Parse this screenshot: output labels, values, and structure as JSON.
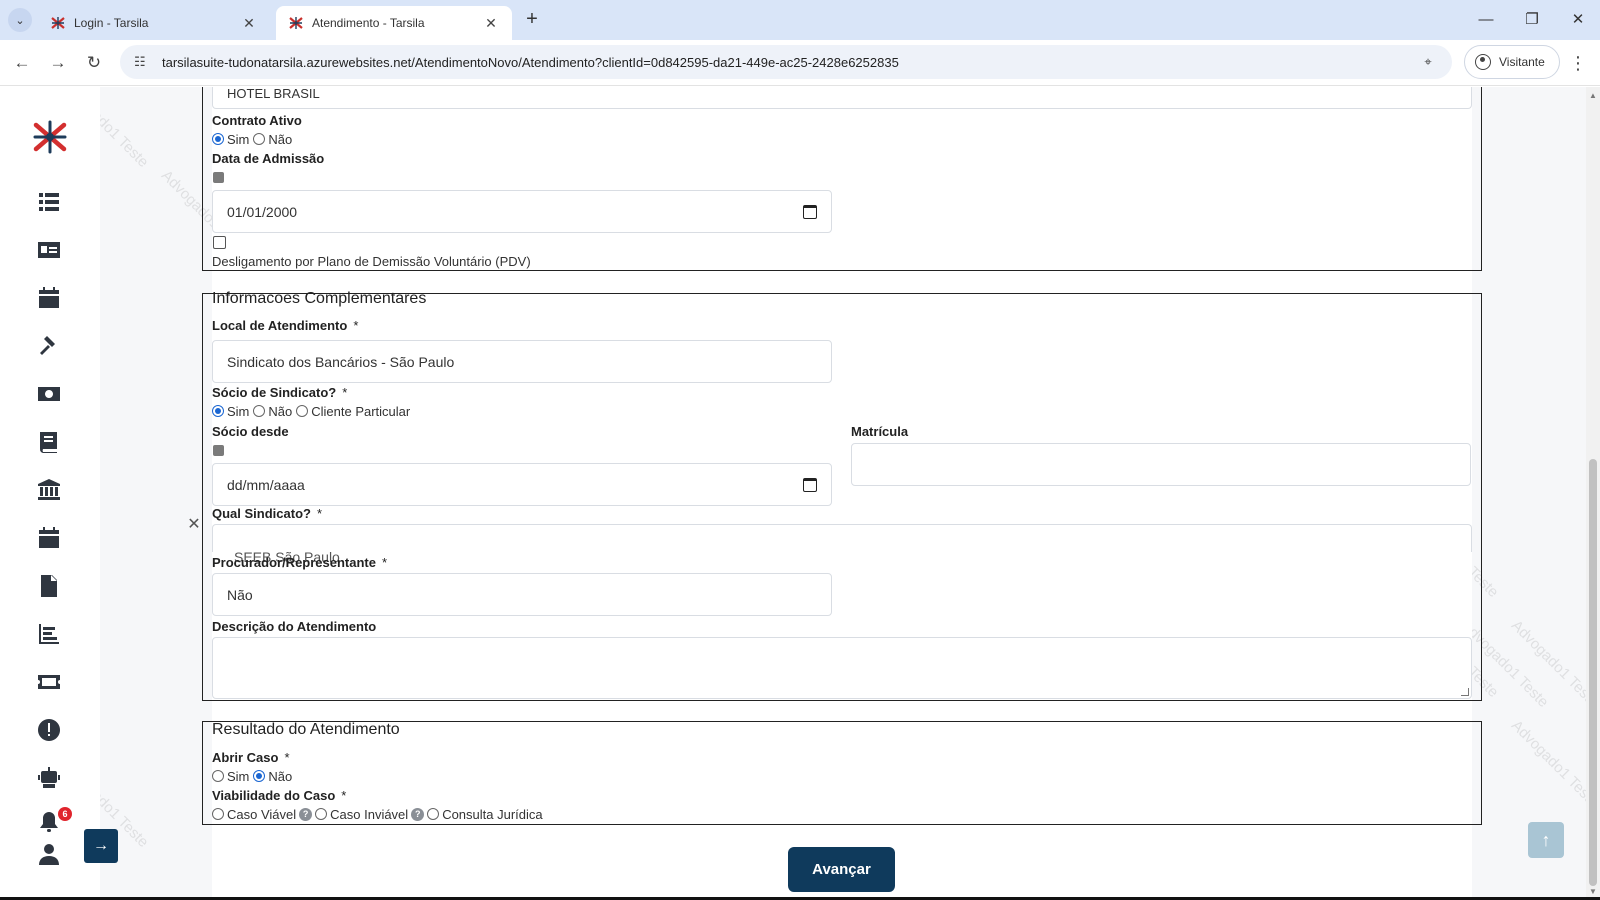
{
  "browser": {
    "tabs": [
      {
        "title": "Login - Tarsila",
        "active": false
      },
      {
        "title": "Atendimento - Tarsila",
        "active": true
      }
    ],
    "url": "tarsilasuite-tudonatarsila.azurewebsites.net/AtendimentoNovo/Atendimento?clientId=0d842595-da21-449e-ac25-2428e6252835",
    "profile_label": "Visitante"
  },
  "watermark_text": "Advogado1 Teste",
  "sidebar": {
    "icons": [
      "list-icon",
      "id-card-icon",
      "calendar-icon",
      "gavel-icon",
      "money-icon",
      "book-icon",
      "bank-icon",
      "calendar-icon",
      "document-icon",
      "chart-icon",
      "ticket-icon",
      "alert-icon",
      "robot-icon",
      "bell-icon",
      "user-icon"
    ],
    "notification_count": "6"
  },
  "contract": {
    "company_value": "HOTEL BRASIL",
    "active_label": "Contrato Ativo",
    "active_options": [
      "Sim",
      "Não"
    ],
    "active_selected": "Sim",
    "admission_label": "Data de Admissão",
    "admission_value": "01/01/2000",
    "pdv_label": "Desligamento por Plano de Demissão Voluntário (PDV)"
  },
  "complementary": {
    "legend": "Informacoes Complementares",
    "local_label": "Local de Atendimento",
    "local_value": "Sindicato dos Bancários - São Paulo",
    "socio_label": "Sócio de Sindicato?",
    "socio_options": [
      "Sim",
      "Não",
      "Cliente Particular"
    ],
    "socio_selected": "Sim",
    "socio_desde_label": "Sócio desde",
    "socio_desde_placeholder": "dd/mm/aaaa",
    "matricula_label": "Matrícula",
    "qual_sindicato_label": "Qual Sindicato?",
    "qual_sindicato_value": "SEEB São Paulo",
    "procurador_label": "Procurador/Representante",
    "procurador_value": "Não",
    "descricao_label": "Descrição do Atendimento",
    "required_mark": "*"
  },
  "result": {
    "legend": "Resultado do Atendimento",
    "abrir_caso_label": "Abrir Caso",
    "abrir_caso_options": [
      "Sim",
      "Não"
    ],
    "abrir_caso_selected": "Não",
    "viabilidade_label": "Viabilidade do Caso",
    "viabilidade_options": [
      "Caso Viável",
      "Caso Inviável",
      "Consulta Jurídica"
    ]
  },
  "actions": {
    "submit_label": "Avançar"
  }
}
